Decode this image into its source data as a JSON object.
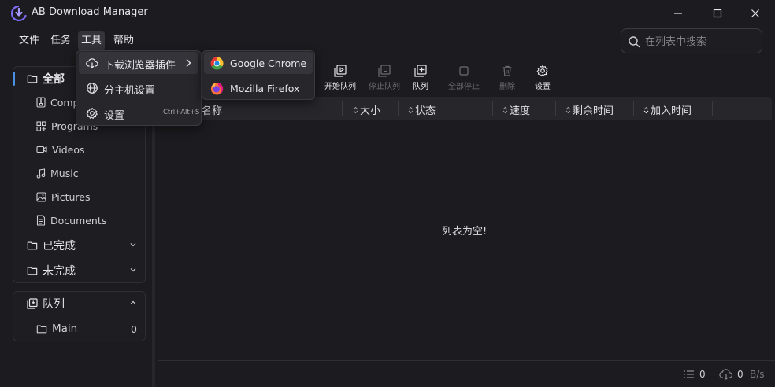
{
  "window": {
    "title": "AB Download Manager",
    "controls": [
      "minimize",
      "maximize",
      "close"
    ]
  },
  "menubar": {
    "file": "文件",
    "task": "任务",
    "tools": "工具",
    "help": "帮助"
  },
  "search": {
    "placeholder": "在列表中搜索",
    "value": ""
  },
  "tools_menu": {
    "browser_plugins": "下载浏览器插件",
    "host_settings": "分主机设置",
    "settings": "设置",
    "settings_shortcut": "Ctrl+Alt+S"
  },
  "browser_menu": {
    "chrome": "Google Chrome",
    "firefox": "Mozilla Firefox"
  },
  "sidebar": {
    "all": "全部",
    "categories": [
      {
        "label": "Comp",
        "icon": "compressed-icon"
      },
      {
        "label": "Programs",
        "icon": "programs-icon"
      },
      {
        "label": "Videos",
        "icon": "video-icon"
      },
      {
        "label": "Music",
        "icon": "music-icon"
      },
      {
        "label": "Pictures",
        "icon": "picture-icon"
      },
      {
        "label": "Documents",
        "icon": "document-icon"
      }
    ],
    "finished": "已完成",
    "unfinished": "未完成",
    "queues_title": "队列",
    "queues": [
      {
        "label": "Main",
        "count": "0"
      }
    ]
  },
  "toolbar": {
    "start_queue": "开始队列",
    "stop_queue": "停止队列",
    "queue": "队列",
    "stop_all": "全部停止",
    "delete": "删除",
    "settings": "设置"
  },
  "table": {
    "columns": [
      "名称",
      "大小",
      "状态",
      "速度",
      "剩余时间",
      "加入时间"
    ],
    "empty_text": "列表为空!"
  },
  "statusbar": {
    "active_count": "0",
    "speed_value": "0",
    "speed_unit": "B/s"
  },
  "colors": {
    "background": "#1c1c20",
    "panel": "#26262b",
    "accent": "#4a90e2",
    "logo": "#7b6cf6"
  }
}
